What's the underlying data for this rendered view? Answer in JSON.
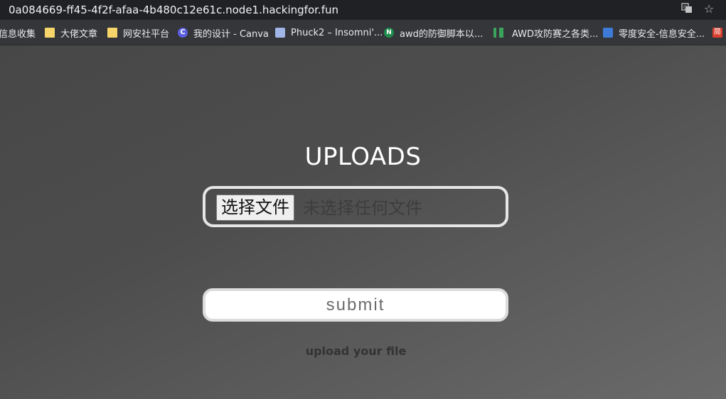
{
  "browser": {
    "url": "0a084669-ff45-4f2f-afaa-4b480c12e61c.node1.hackingfor.fun",
    "translate_icon": "translate-icon",
    "bookmark_star_icon": "star-icon"
  },
  "bookmarks": [
    {
      "label": "信息收集",
      "icon": "folder-icon"
    },
    {
      "label": "大佬文章",
      "icon": "folder-icon"
    },
    {
      "label": "网安社平台",
      "icon": "folder-icon"
    },
    {
      "label": "我的设计 - Canva",
      "icon": "canva-icon"
    },
    {
      "label": "Phuck2 – Insomni'...",
      "icon": "document-icon"
    },
    {
      "label": "awd的防御脚本以...",
      "icon": "n-icon"
    },
    {
      "label": "AWD攻防赛之各类...",
      "icon": "bars-icon"
    },
    {
      "label": "零度安全-信息安全...",
      "icon": "site-icon"
    },
    {
      "label": "简",
      "icon": "site-icon"
    }
  ],
  "main": {
    "title": "UPLOADS",
    "choose_file_label": "选择文件",
    "no_file_text": "未选择任何文件",
    "submit_label": "submit",
    "hint": "upload your file"
  },
  "colors": {
    "bg_dark": "#474747",
    "bg_light": "#6a6a6a",
    "title": "#ffffff",
    "border": "#e6e6e6"
  }
}
